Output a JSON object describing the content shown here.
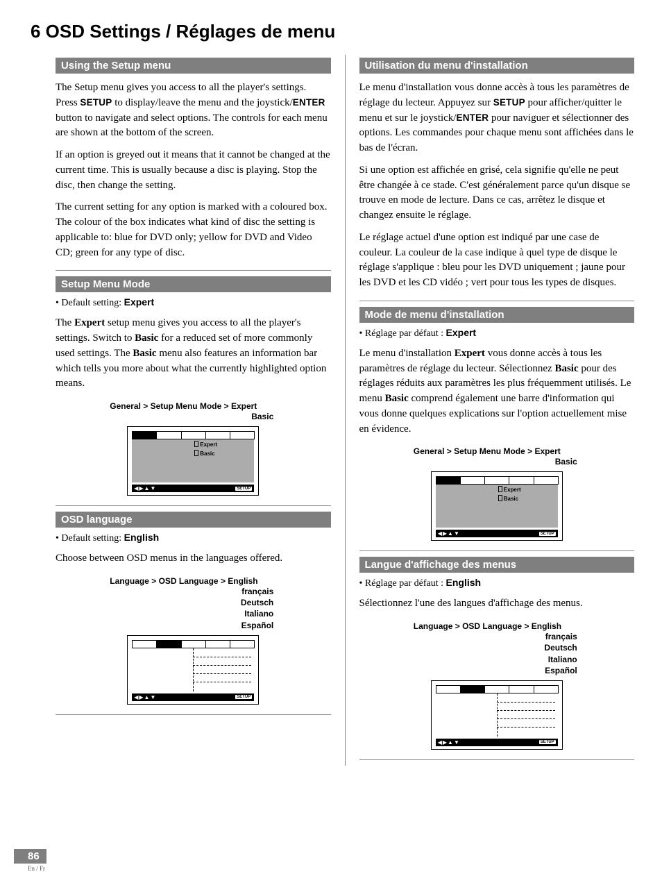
{
  "page_title": "6 OSD Settings / Réglages de menu",
  "left": {
    "s1": {
      "head": "Using the Setup menu",
      "p1a": "The Setup menu gives you access to all the player's settings. Press ",
      "p1_setup": "SETUP",
      "p1b": " to display/leave the menu and the joystick/",
      "p1_enter": "ENTER",
      "p1c": " button to navigate and select options. The controls for each menu are shown at the bottom of the screen.",
      "p2": "If an option is greyed out it means that it cannot be changed at the current time. This is usually because a disc is playing. Stop the disc, then change the setting.",
      "p3": "The current setting for any option is marked with a coloured box. The colour of the box indicates what kind of disc the setting is applicable to: blue for DVD only; yellow for DVD and Video CD; green for any type of disc."
    },
    "s2": {
      "head": "Setup Menu Mode",
      "bullet_pre": "• Default setting: ",
      "bullet_val": "Expert",
      "p1a": "The ",
      "p1_expert": "Expert",
      "p1b": " setup menu gives you access to all the player's settings. Switch to ",
      "p1_basic": "Basic",
      "p1c": " for a reduced set of more commonly used settings. The ",
      "p1_basic2": "Basic",
      "p1d": " menu also features an information bar which tells you more about what the currently highlighted option means.",
      "crumb": "General > Setup Menu Mode > ",
      "crumb_first": "Expert",
      "crumb_opts": [
        "Basic"
      ],
      "drop_rows": [
        "Expert",
        "Basic"
      ]
    },
    "s3": {
      "head": "OSD language",
      "bullet_pre": "• Default setting: ",
      "bullet_val": "English",
      "p1": "Choose between OSD menus in the languages offered.",
      "crumb": "Language > OSD Language > ",
      "crumb_first": "English",
      "crumb_opts": [
        "français",
        "Deutsch",
        "Italiano",
        "Español"
      ]
    }
  },
  "right": {
    "s1": {
      "head": "Utilisation du menu d'installation",
      "p1a": "Le menu d'installation vous donne accès à tous les paramètres de réglage du lecteur. Appuyez sur ",
      "p1_setup": "SETUP",
      "p1b": " pour afficher/quitter le menu et sur le joystick/",
      "p1_enter": "ENTER",
      "p1c": " pour naviguer et sélectionner des options. Les commandes pour chaque menu sont affichées dans le bas de l'écran.",
      "p2": "Si une option est affichée en grisé, cela signifie qu'elle ne peut être changée à ce stade. C'est généralement parce qu'un disque se trouve en mode de lecture. Dans ce cas, arrêtez le disque et changez ensuite le réglage.",
      "p3": "Le réglage actuel d'une option est indiqué par une case de couleur. La couleur de la case indique à quel type de disque le réglage s'applique : bleu pour les DVD uniquement ; jaune pour les DVD et les CD vidéo ; vert pour tous les types de disques."
    },
    "s2": {
      "head": "Mode de menu d'installation",
      "bullet_pre": "• Réglage par défaut : ",
      "bullet_val": "Expert",
      "p1a": "Le menu d'installation ",
      "p1_expert": "Expert",
      "p1b": " vous donne accès à tous les paramètres de réglage du lecteur. Sélectionnez ",
      "p1_basic": "Basic",
      "p1c": " pour des réglages réduits aux paramètres les plus fréquemment utilisés. Le menu ",
      "p1_basic2": "Basic",
      "p1d": " comprend également une barre d'information qui vous donne quelques explications sur l'option actuellement mise en évidence.",
      "crumb": "General > Setup Menu Mode > ",
      "crumb_first": "Expert",
      "crumb_opts": [
        "Basic"
      ],
      "drop_rows": [
        "Expert",
        "Basic"
      ]
    },
    "s3": {
      "head": "Langue d'affichage des menus",
      "bullet_pre": "• Réglage par défaut : ",
      "bullet_val": "English",
      "p1": "Sélectionnez l'une des langues d'affichage des menus.",
      "crumb": "Language > OSD Language > ",
      "crumb_first": "English",
      "crumb_opts": [
        "français",
        "Deutsch",
        "Italiano",
        "Español"
      ]
    }
  },
  "osd": {
    "arrows": "◀▶▲▼",
    "setup": "SETUP"
  },
  "footer": {
    "page": "86",
    "langs": "En / Fr"
  }
}
